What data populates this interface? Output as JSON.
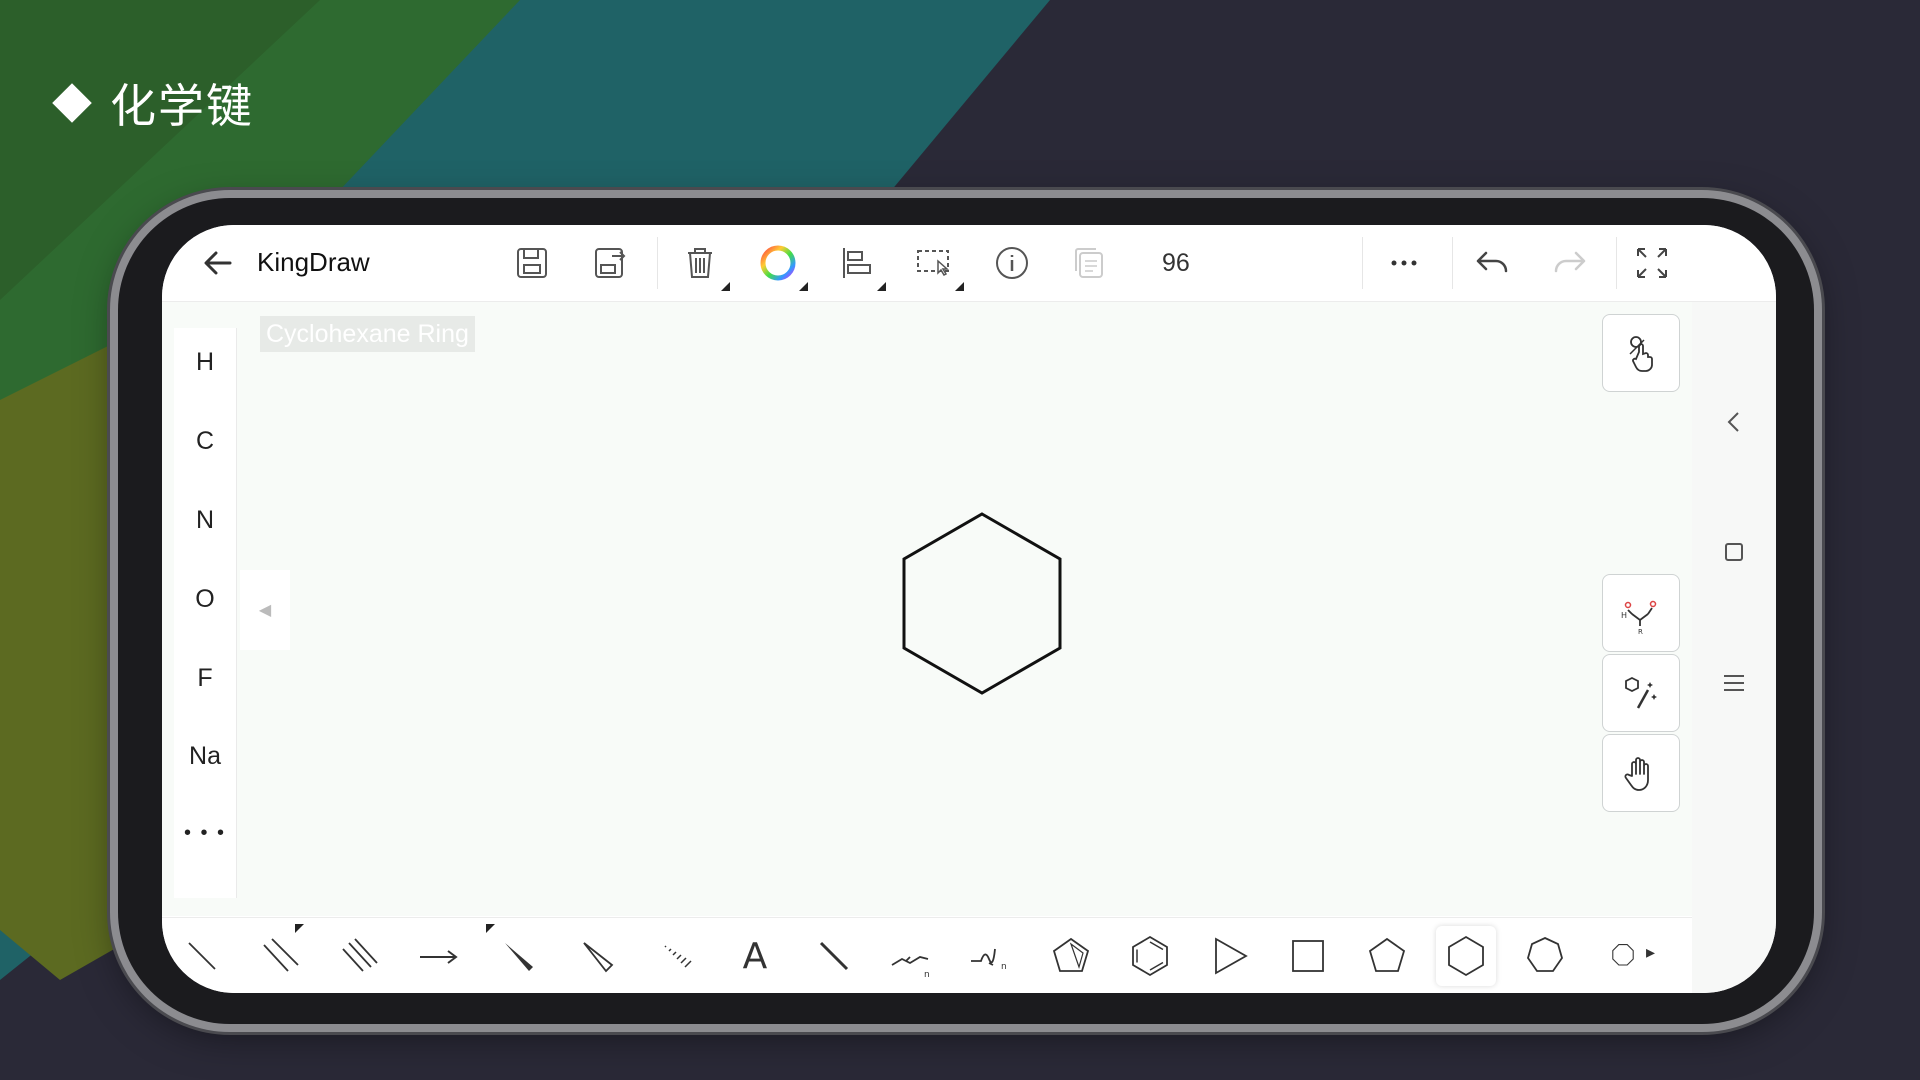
{
  "slide": {
    "title": "化学键"
  },
  "toolbar": {
    "app_title": "KingDraw",
    "counter": "96"
  },
  "canvas": {
    "structure_name": "Cyclohexane Ring"
  },
  "element_panel": {
    "items": [
      "H",
      "C",
      "N",
      "O",
      "F",
      "Na"
    ],
    "more_label": "• • •"
  },
  "bottom_tools": {
    "text_tool_label": "A",
    "more_arrow": "▸"
  },
  "colors": {
    "accent_ring": "rainbow",
    "background": "#2a2937"
  }
}
